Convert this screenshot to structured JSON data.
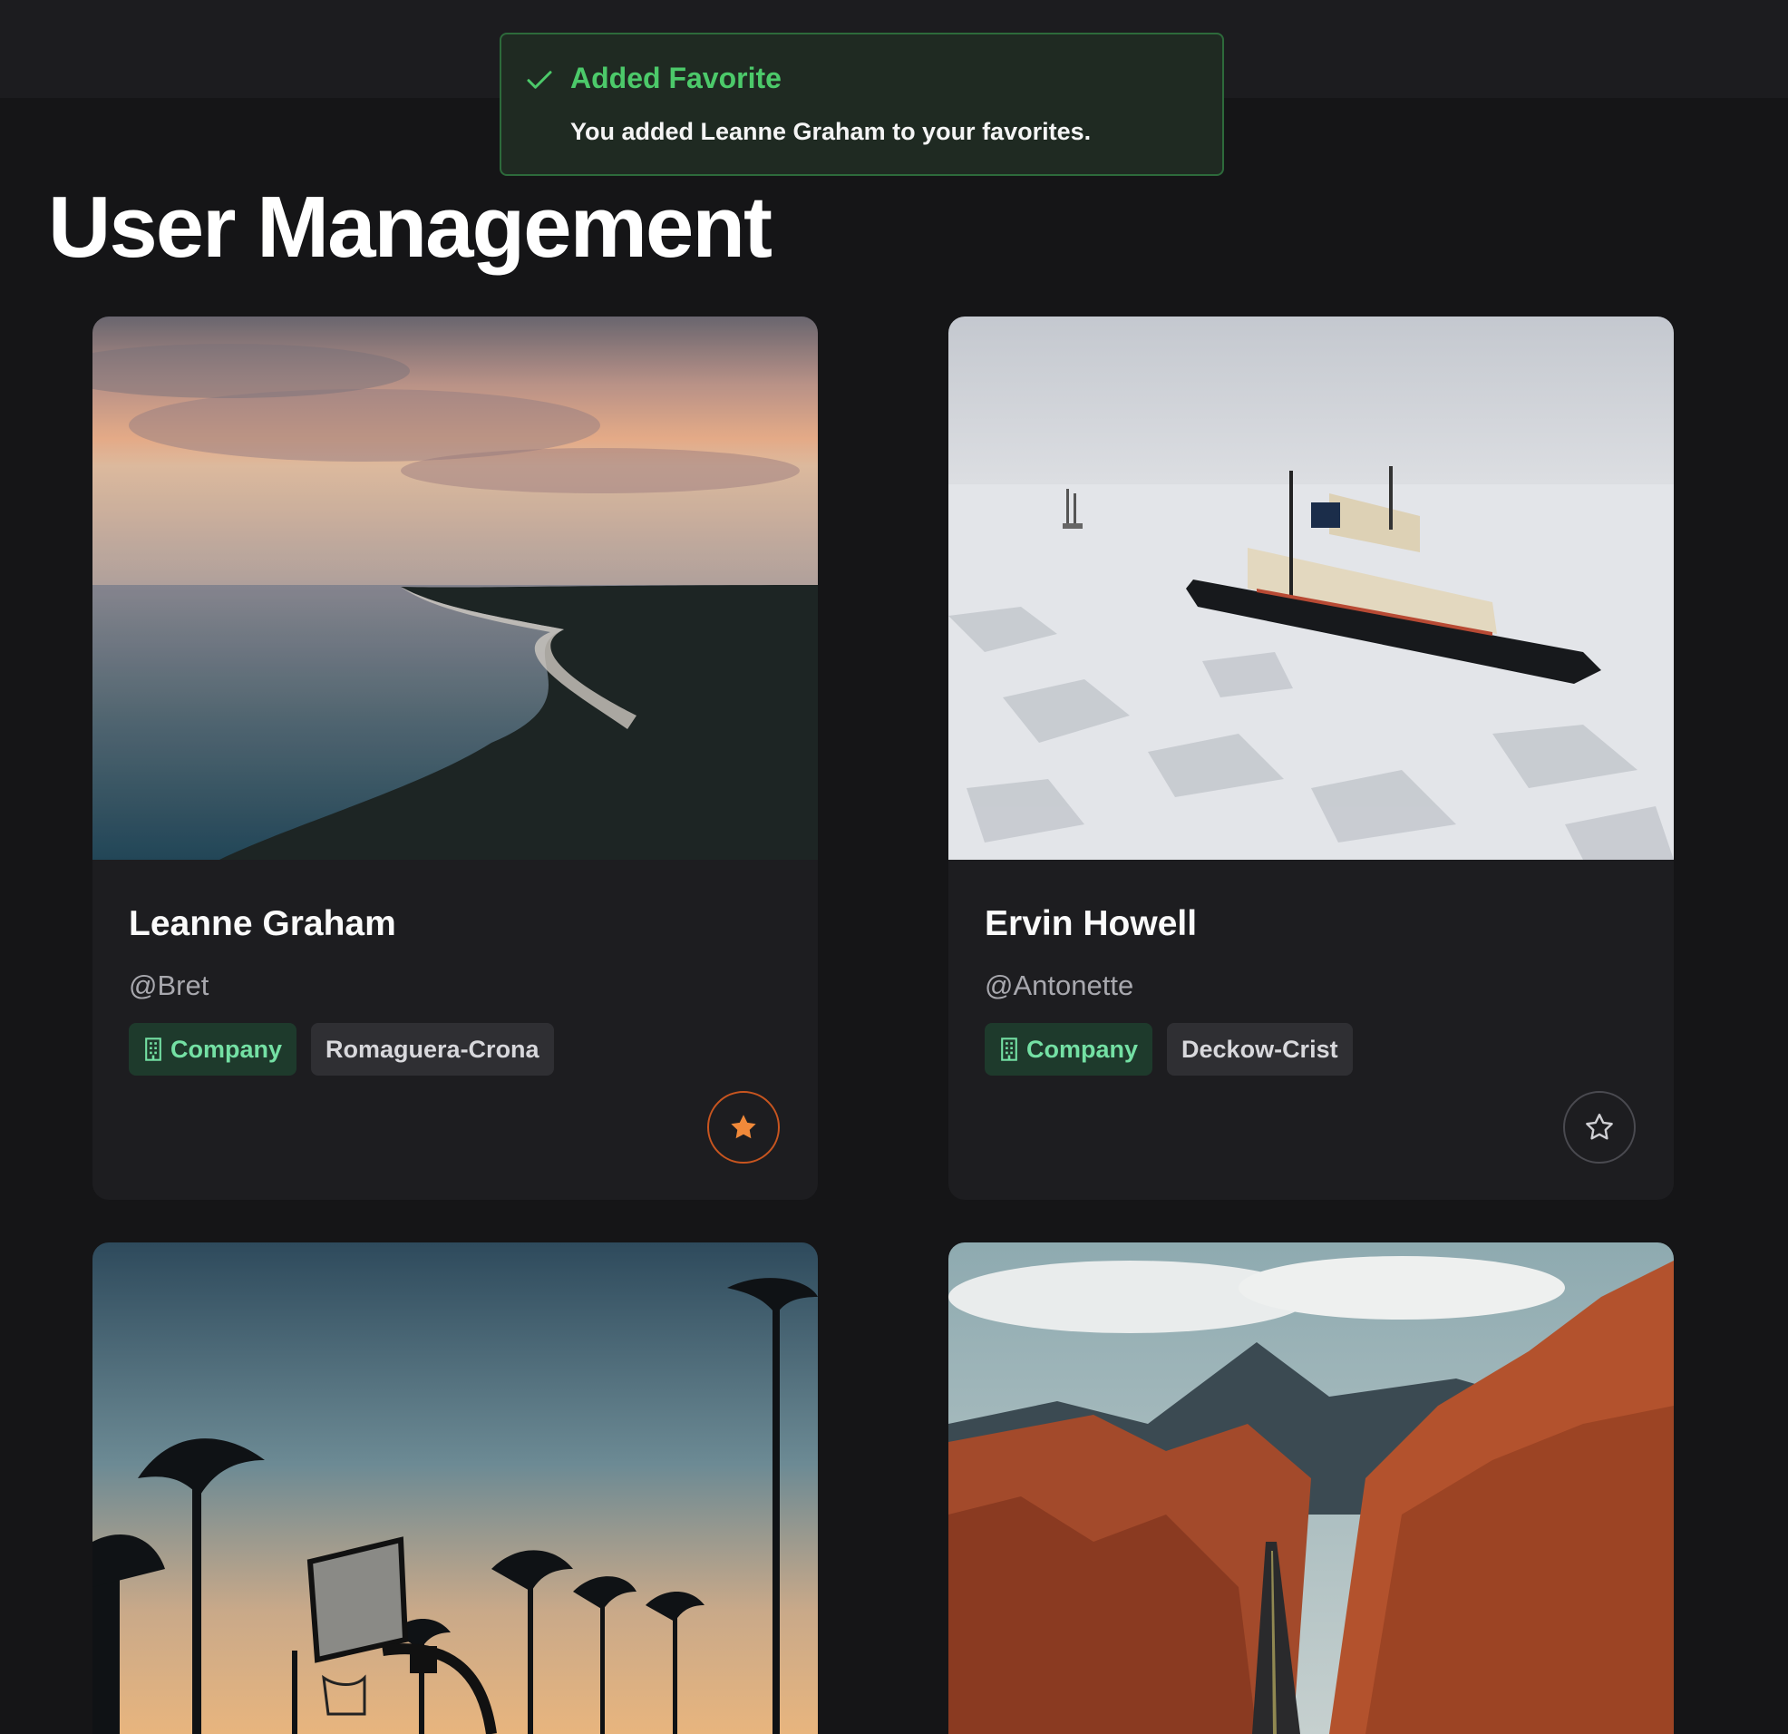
{
  "toast": {
    "title": "Added Favorite",
    "message": "You added Leanne Graham to your favorites.",
    "accent": "#4cc96a"
  },
  "page": {
    "title": "User Management"
  },
  "users": [
    {
      "name": "Leanne Graham",
      "handle": "@Bret",
      "company_label": "Company",
      "company": "Romaguera-Crona",
      "favorite": true,
      "photo": "sunset-coastline"
    },
    {
      "name": "Ervin Howell",
      "handle": "@Antonette",
      "company_label": "Company",
      "company": "Deckow-Crist",
      "favorite": false,
      "photo": "icebreaker-ship"
    },
    {
      "photo": "palm-trees-basketball-hoop"
    },
    {
      "photo": "red-rock-canyon-road"
    }
  ],
  "colors": {
    "background": "#151517",
    "card": "#1d1d20",
    "company_tag_text": "#74e0a4",
    "favorite_active": "#f0893a"
  }
}
